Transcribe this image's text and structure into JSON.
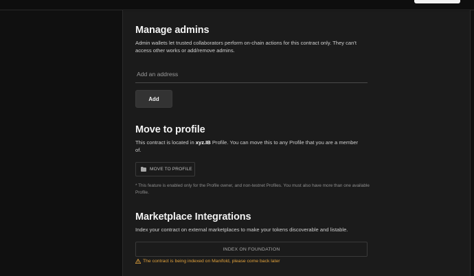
{
  "manage_admins": {
    "title": "Manage admins",
    "description": "Admin wallets let trusted collaborators perform on-chain actions for this contract only. They can't access other works or add/remove admins.",
    "address_placeholder": "Add an address",
    "add_label": "Add"
  },
  "move_to_profile": {
    "title": "Move to profile",
    "desc_before": "This contract is located in ",
    "profile_name": "xyz.IB",
    "desc_after": " Profile. You can move this to any Profile that you are a member of.",
    "button_label": "MOVE TO PROFILE",
    "note": "* This feature is enabled only for the Profile owner, and non-testnet Profiles. You must also have more than one available Profile."
  },
  "marketplace": {
    "title": "Marketplace Integrations",
    "description": "Index your contract on external marketplaces to make your tokens discoverable and listable.",
    "index_label": "INDEX ON FOUNDATION",
    "warning": "The contract is being indexed on Manifold, please come back later"
  },
  "colors": {
    "background": "#101010",
    "panel": "#1b1b1b",
    "warning": "#e0a13c"
  },
  "icons": {
    "move_button": "folder-icon",
    "warning": "warning-triangle-icon"
  }
}
